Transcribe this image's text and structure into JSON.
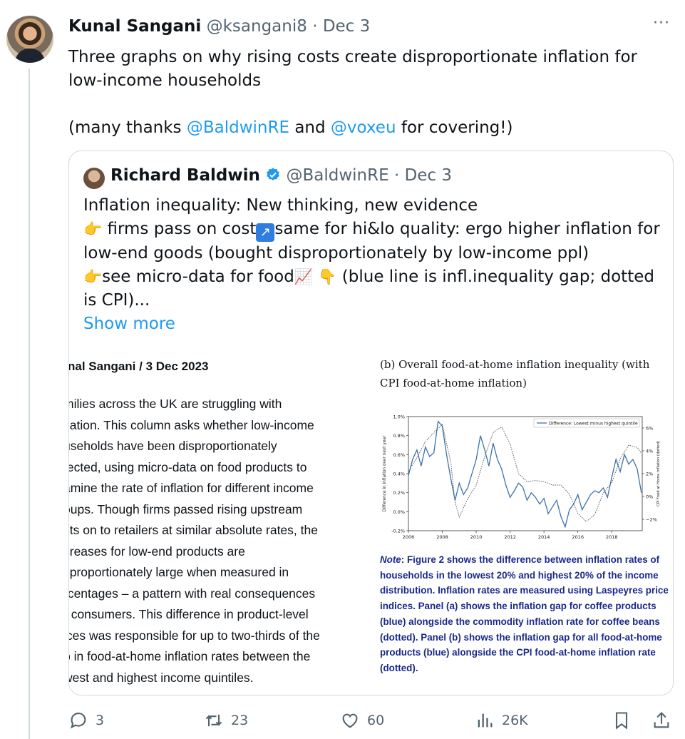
{
  "tweet": {
    "author_name": "Kunal Sangani",
    "author_handle": "@ksangani8",
    "date": "Dec 3",
    "more_label": "···",
    "line1": "Three graphs on why rising costs create disproportionate inflation for low-income households",
    "thanks_prefix": "(many thanks ",
    "mention1": "@BaldwinRE",
    "thanks_mid": " and ",
    "mention2": "@voxeu",
    "thanks_suffix": " for covering!)"
  },
  "quote": {
    "author_name": "Richard Baldwin",
    "author_handle": "@BaldwinRE",
    "date": "Dec 3",
    "line1": "Inflation inequality: New thinking, new evidence",
    "line2a": " firms pass on cost",
    "line2b": "same for hi&lo quality: ergo higher inflation for low-end goods (bought disproportionately by low-income ppl)",
    "line3a": "see micro-data for food",
    "line3b": " (blue line is infl.inequality gap; dotted is CPI)...",
    "show_more": "Show more",
    "emoji_point_right": "👉",
    "emoji_chart": "📈",
    "emoji_point_down": "👇",
    "arrow_glyph": "↗"
  },
  "article": {
    "byline": "nal Sangani / 3 Dec 2023",
    "lines": [
      "milies across the UK are struggling with",
      "flation. This column asks whether low-income",
      "useholds have been disproportionately",
      "fected, using micro-data on food products to",
      "amine the rate of inflation for different income",
      "oups. Though firms passed rising upstream",
      "sts on to retailers at similar absolute rates, the",
      "creases for low-end products are",
      "sproportionately large when measured in",
      "rcentages – a pattern with real consequences",
      "r consumers. This difference in product-level",
      "ices was responsible for up to two-thirds of the",
      "p in food-at-home inflation rates between the",
      "west and highest income quintiles."
    ]
  },
  "figure": {
    "title": "(b) Overall food-at-home inflation inequality (with CPI food-at-home inflation)",
    "note_label": "Note",
    "note_text": ": Figure 2 shows the difference between inflation rates of households in the lowest 20% and highest 20% of the income distribution. Inflation rates are measured using Laspeyres price indices. Panel (a) shows the inflation gap for coffee products (blue) alongside the commodity inflation rate for coffee beans (dotted). Panel (b) shows the inflation gap for all food-at-home products (blue) alongside the CPI food-at-home inflation rate (dotted)."
  },
  "chart_data": {
    "type": "line",
    "title": "",
    "xlabel": "",
    "ylabel": "Difference in inflation over next year",
    "ylabel_right": "CPI Food at Home Inflation (dotted)",
    "xlim": [
      2006,
      2019.8
    ],
    "ylim": [
      -0.2,
      1.0
    ],
    "ylim_right": [
      -3,
      7
    ],
    "x_ticks": [
      "2006",
      "2008",
      "2010",
      "2012",
      "2014",
      "2016",
      "2018"
    ],
    "y_ticks": [
      "-0.2%",
      "0.0%",
      "0.2%",
      "0.4%",
      "0.6%",
      "0.8%",
      "1.0%"
    ],
    "y_ticks_right": [
      "−2%",
      "0%",
      "2%",
      "4%",
      "6%"
    ],
    "legend": "top-right",
    "colors": {
      "series": "#3d72a8",
      "cpi": "#555555"
    },
    "series": [
      {
        "name": "Difference: Lowest minus highest quintile",
        "x": [
          2006.0,
          2006.25,
          2006.5,
          2006.75,
          2007.0,
          2007.25,
          2007.5,
          2007.75,
          2008.0,
          2008.25,
          2008.5,
          2008.75,
          2009.0,
          2009.25,
          2009.5,
          2009.75,
          2010.0,
          2010.25,
          2010.5,
          2010.75,
          2011.0,
          2011.25,
          2011.5,
          2011.75,
          2012.0,
          2012.25,
          2012.5,
          2012.75,
          2013.0,
          2013.25,
          2013.5,
          2013.75,
          2014.0,
          2014.25,
          2014.5,
          2014.75,
          2015.0,
          2015.25,
          2015.5,
          2015.75,
          2016.0,
          2016.25,
          2016.5,
          2016.75,
          2017.0,
          2017.25,
          2017.5,
          2017.75,
          2018.0,
          2018.25,
          2018.5,
          2018.75,
          2019.0,
          2019.25,
          2019.5,
          2019.75
        ],
        "values": [
          0.38,
          0.55,
          0.65,
          0.48,
          0.68,
          0.58,
          0.62,
          0.95,
          0.9,
          0.6,
          0.35,
          0.12,
          0.3,
          0.18,
          0.25,
          0.4,
          0.55,
          0.8,
          0.65,
          0.48,
          0.72,
          0.55,
          0.45,
          0.28,
          0.15,
          0.22,
          0.3,
          0.26,
          0.12,
          0.2,
          0.15,
          0.08,
          0.14,
          -0.02,
          0.05,
          0.12,
          -0.05,
          -0.16,
          0.02,
          0.08,
          0.18,
          0.02,
          0.1,
          0.18,
          0.22,
          0.2,
          0.25,
          0.15,
          0.36,
          0.55,
          0.42,
          0.6,
          0.5,
          0.55,
          0.45,
          0.2
        ]
      },
      {
        "name": "CPI food-at-home inflation",
        "x": [
          2006.0,
          2006.5,
          2007.0,
          2007.5,
          2008.0,
          2008.5,
          2008.75,
          2009.0,
          2009.5,
          2010.0,
          2010.5,
          2011.0,
          2011.5,
          2012.0,
          2012.5,
          2013.0,
          2013.5,
          2014.0,
          2014.5,
          2015.0,
          2015.5,
          2016.0,
          2016.5,
          2017.0,
          2017.5,
          2018.0,
          2018.5,
          2019.0,
          2019.5,
          2019.75
        ],
        "values": [
          2.2,
          3.4,
          4.8,
          5.6,
          6.3,
          3.0,
          -0.5,
          -1.8,
          -0.2,
          1.0,
          3.5,
          5.6,
          6.1,
          4.6,
          2.0,
          1.3,
          1.4,
          1.3,
          1.0,
          1.0,
          0.2,
          -1.5,
          -2.2,
          -1.6,
          0.3,
          1.2,
          3.3,
          4.5,
          4.3,
          3.8
        ]
      }
    ]
  },
  "actions": {
    "replies": "3",
    "retweets": "23",
    "likes": "60",
    "views": "26K"
  }
}
